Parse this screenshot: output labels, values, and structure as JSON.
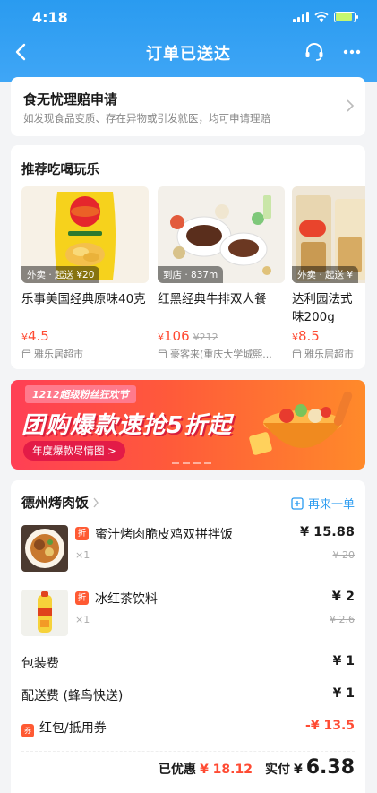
{
  "status_bar": {
    "time": "4:18"
  },
  "navbar": {
    "title": "订单已送达"
  },
  "claim": {
    "title": "食无忧理赔申请",
    "description": "如发现食品变质、存在异物或引发就医，均可申请理赔"
  },
  "recommend": {
    "title": "推荐吃喝玩乐",
    "items": [
      {
        "tag": "外卖 · 起送 ¥20",
        "name": "乐事美国经典原味40克",
        "currency": "¥",
        "price": "4.5",
        "original": "",
        "store": "雅乐居超市"
      },
      {
        "tag": "到店 · 837m",
        "name": "红黑经典牛排双人餐",
        "currency": "¥",
        "price": "106",
        "original": "¥212",
        "store": "豪客来(重庆大学城熙..."
      },
      {
        "tag": "外卖 · 起送 ¥",
        "name": "达利园法式味200g",
        "currency": "¥",
        "price": "8.5",
        "original": "",
        "store": "雅乐居超市"
      }
    ]
  },
  "banner": {
    "top_label": "1212超级粉丝狂欢节",
    "headline": "团购爆款速抢5折起",
    "button": "年度爆款尽情图 >"
  },
  "order": {
    "shop_name": "德州烤肉饭",
    "reorder_label": "再来一单",
    "items": [
      {
        "badge": "折",
        "name": "蜜汁烤肉脆皮鸡双拼拌饭",
        "qty": "×1",
        "price": "¥ 15.88",
        "original": "¥ 20"
      },
      {
        "badge": "折",
        "name": "冰红茶饮料",
        "qty": "×1",
        "price": "¥ 2",
        "original": "¥ 2.6"
      }
    ],
    "fees": [
      {
        "label": "包装费",
        "value": "¥ 1"
      },
      {
        "label": "配送费 (蜂鸟快送)",
        "value": "¥ 1"
      }
    ],
    "coupon": {
      "icon_text": "券",
      "label": "红包/抵用券",
      "value": "-¥ 13.5"
    },
    "summary": {
      "discount_label": "已优惠",
      "discount_value": "¥ 18.12",
      "paid_label": "实付",
      "paid_currency": "¥",
      "paid_value": "6.38"
    }
  },
  "colors": {
    "brand_blue": "#2a9bf0",
    "price_red": "#ff4b33",
    "badge_orange": "#ff5a33"
  },
  "icons": [
    "back-icon",
    "headset-icon",
    "more-icon",
    "chevron-right-icon",
    "store-icon",
    "refresh-order-icon"
  ]
}
